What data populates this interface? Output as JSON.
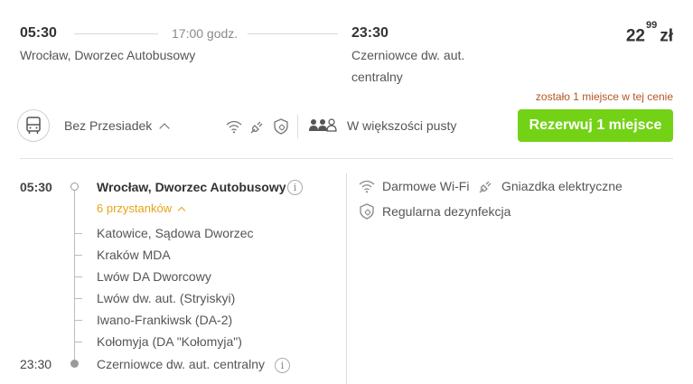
{
  "trip": {
    "departure_time": "05:30",
    "departure_station": "Wrocław, Dworzec Autobusowy",
    "duration": "17:00 godz.",
    "arrival_time": "23:30",
    "arrival_station_line1": "Czerniowce dw. aut.",
    "arrival_station_line2": "centralny",
    "price_main": "22",
    "price_cents": "99",
    "price_currency": "zł",
    "seats_notice": "zostało 1 miejsce w tej cenie"
  },
  "summary": {
    "transfers_label": "Bez Przesiadek",
    "occupancy_label": "W większości pusty",
    "book_button_label": "Rezerwuj 1 miejsce"
  },
  "route": {
    "start_time": "05:30",
    "start_station": "Wrocław, Dworzec Autobusowy",
    "stops_count_label": "6 przystanków",
    "stops": [
      "Katowice, Sądowa Dworzec",
      "Kraków MDA",
      "Lwów DA Dworcowy",
      "Lwów dw. aut. (Stryiskyi)",
      "Iwano-Frankiwsk (DA-2)",
      "Kołomyja (DA \"Kołomyja\")"
    ],
    "end_time": "23:30",
    "end_station": "Czerniowce dw. aut. centralny"
  },
  "amenities": {
    "wifi": "Darmowe Wi-Fi",
    "socket": "Gniazdka elektryczne",
    "disinfection": "Regularna dezynfekcja"
  },
  "colors": {
    "accent_green": "#73d216",
    "stops_orange": "#e8a317",
    "notice_brown": "#b5541f"
  }
}
